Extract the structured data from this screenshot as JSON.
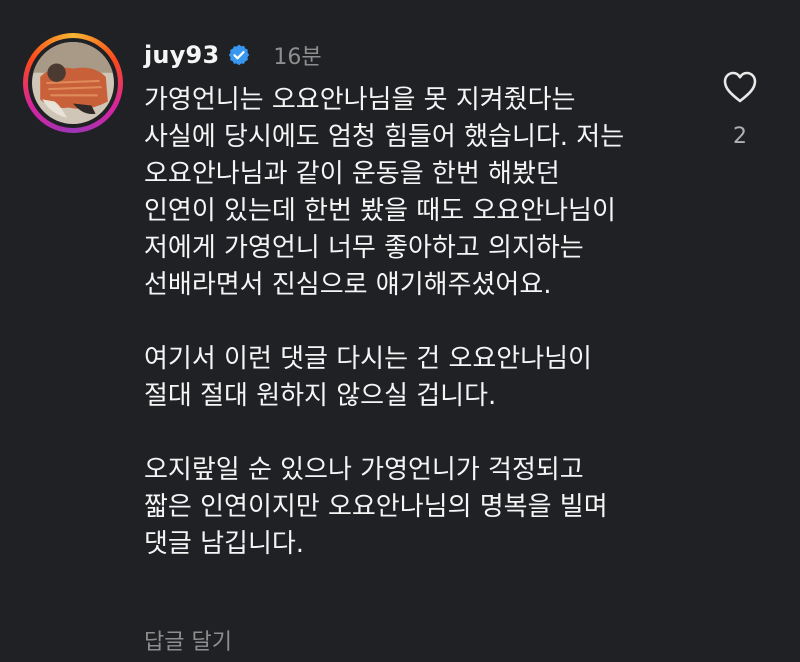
{
  "comment": {
    "author": {
      "username": "juy93",
      "verified_icon": "verified-badge-icon",
      "avatar": "profile-photo"
    },
    "time_ago": "16분",
    "paragraphs": [
      [
        "가영언니는 오요안나님을 못 지켜줬다는",
        "사실에 당시에도 엄청 힘들어 했습니다. 저는",
        "오요안나님과 같이 운동을 한번 해봤던",
        "인연이 있는데 한번 봤을 때도 오요안나님이",
        "저에게 가영언니 너무 좋아하고 의지하는",
        "선배라면서 진심으로 얘기해주셨어요."
      ],
      [
        "여기서 이런 댓글 다시는 건 오요안나님이",
        "절대 절대 원하지 않으실 겁니다."
      ],
      [
        "오지랖일 순 있으나 가영언니가 걱정되고",
        "짧은 인연이지만 오요안나님의 명복을 빌며",
        "댓글 남깁니다."
      ]
    ],
    "reply_label": "답글 달기",
    "like": {
      "icon": "heart-icon",
      "count": "2"
    }
  },
  "colors": {
    "background": "#1f2124",
    "text": "#f5f5f5",
    "muted": "#8e8e8e",
    "verified_blue": "#3897f0"
  }
}
